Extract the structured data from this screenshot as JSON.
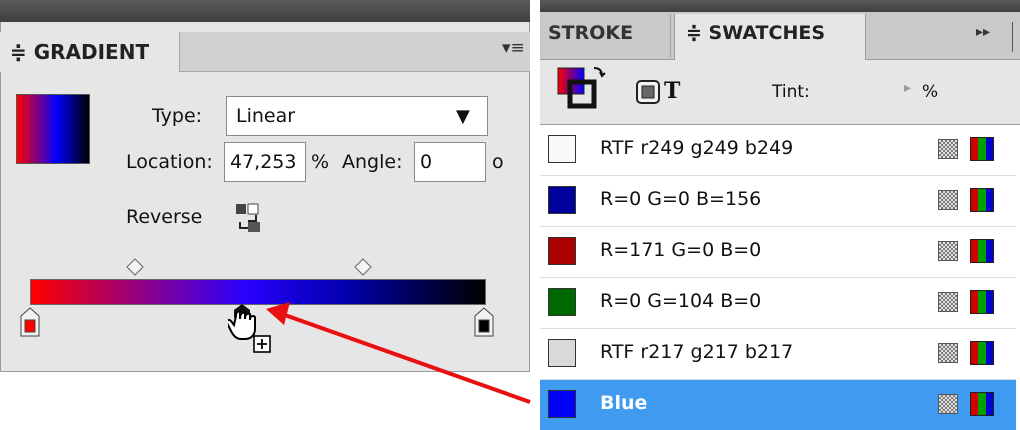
{
  "gradient_panel": {
    "tab_label": "≑ GRADIENT",
    "collapse_glyph": "◂◂",
    "close_glyph": "✕",
    "menu_icon": "panel-menu-icon",
    "type_label": "Type:",
    "type_value": "Linear",
    "location_label": "Location:",
    "location_value": "47,253",
    "location_unit": "%",
    "angle_label": "Angle:",
    "angle_value": "0",
    "angle_unit": "o",
    "reverse_label": "Reverse",
    "ramp_colors": [
      "#ff0000",
      "#0000ff",
      "#000000"
    ],
    "stop_left_color": "#ff0000",
    "stop_right_color": "#000000"
  },
  "swatches_panel": {
    "tabs": [
      {
        "label": "STROKE"
      },
      {
        "label": "≑ SWATCHES"
      }
    ],
    "expand_glyph": "▸▸",
    "tint_label": "Tint:",
    "tint_unit": "%",
    "swatches": [
      {
        "name": "RTF r249 g249 b249",
        "color": "#f9f9f9",
        "selected": false
      },
      {
        "name": "R=0 G=0 B=156",
        "color": "#00009c",
        "selected": false
      },
      {
        "name": "R=171 G=0 B=0",
        "color": "#ab0000",
        "selected": false
      },
      {
        "name": "R=0 G=104 B=0",
        "color": "#006800",
        "selected": false
      },
      {
        "name": "RTF r217 g217 b217",
        "color": "#d9d9d9",
        "selected": false
      },
      {
        "name": "Blue",
        "color": "#0000ff",
        "selected": true
      }
    ]
  },
  "colors": {
    "selection": "#3f9bef",
    "annotation_arrow": "#e81010"
  }
}
